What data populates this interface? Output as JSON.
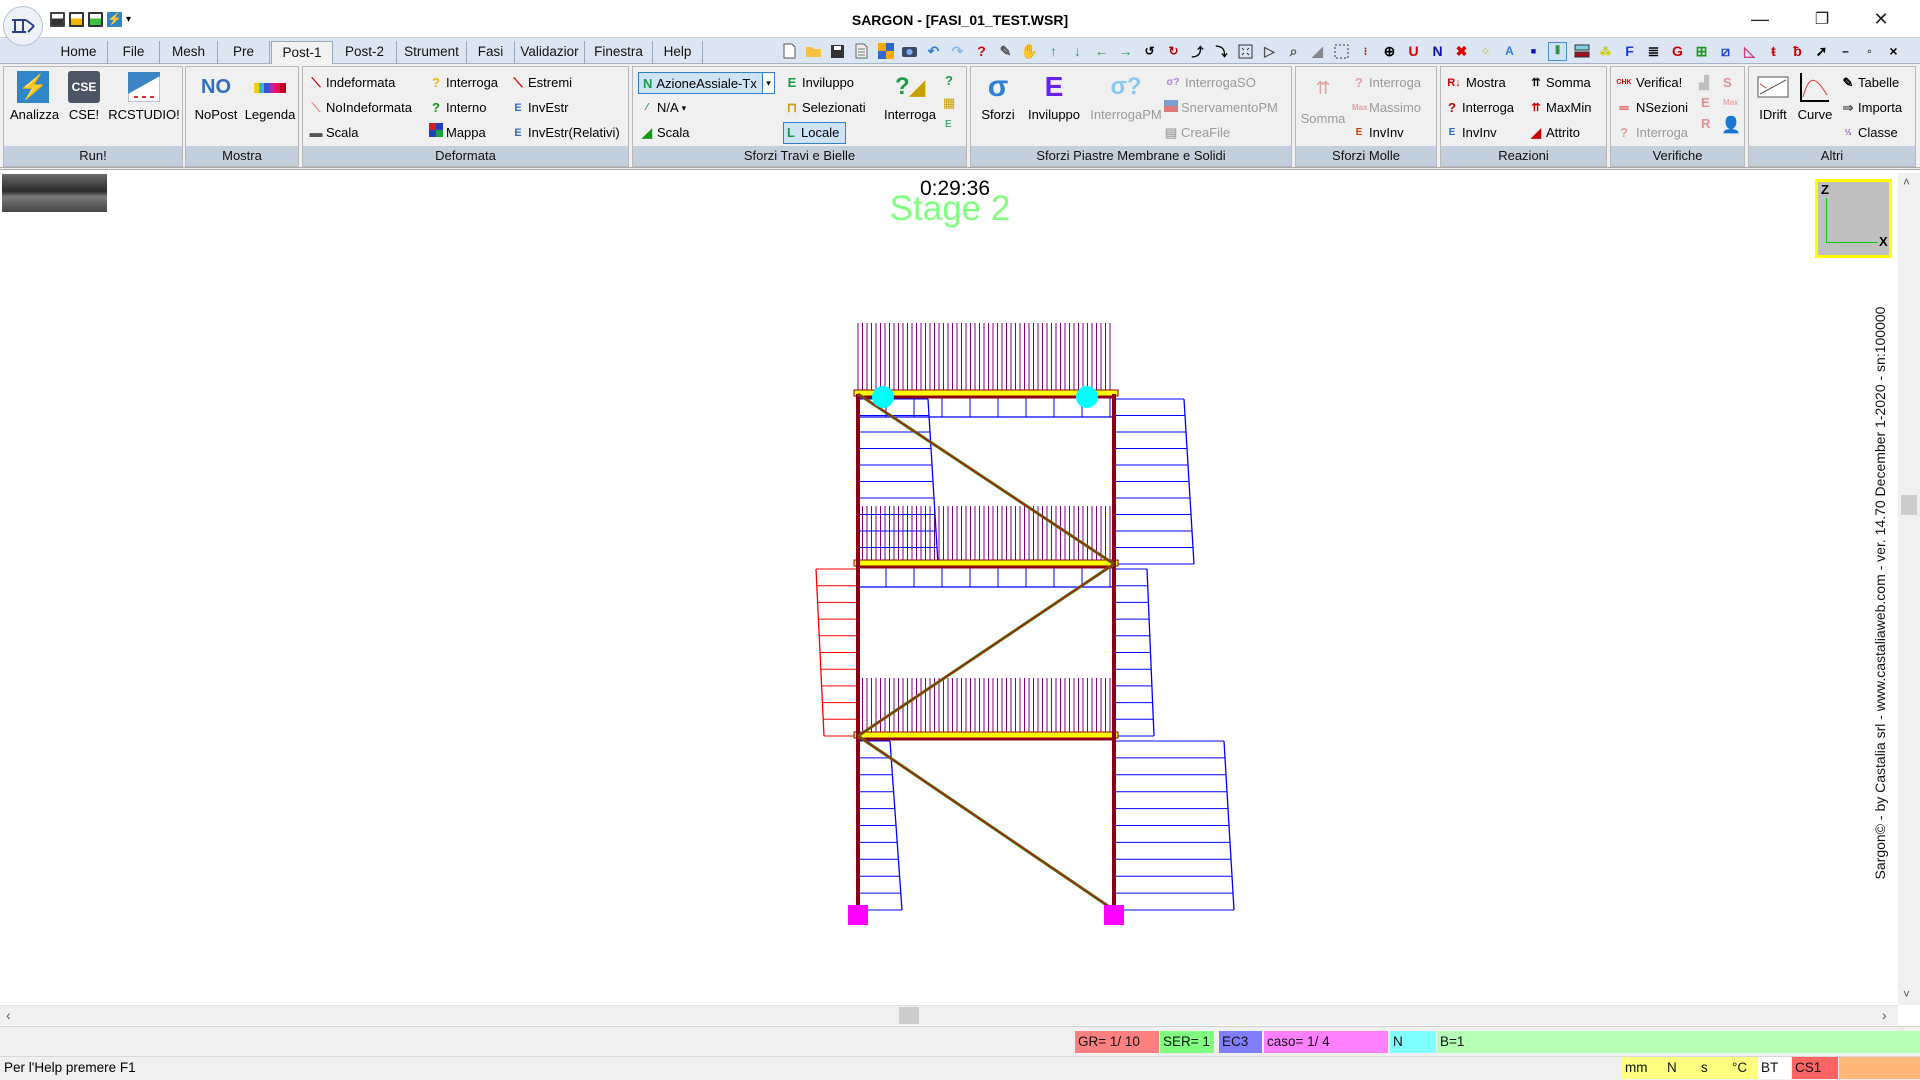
{
  "window": {
    "title": "SARGON - [FASI_01_TEST.WSR]",
    "controls": {
      "minimize": "—",
      "restore": "❐",
      "close": "✕"
    }
  },
  "quick_access": [
    "save-icon",
    "save-as-icon",
    "save-all-icon",
    "analyze-icon",
    "customize-icon"
  ],
  "menu": {
    "tabs": [
      {
        "label": "Home"
      },
      {
        "label": "File"
      },
      {
        "label": "Mesh"
      },
      {
        "label": "Pre"
      },
      {
        "label": "Post-1",
        "active": true
      },
      {
        "label": "Post-2"
      },
      {
        "label": "Strument"
      },
      {
        "label": "Fasi"
      },
      {
        "label": "Validazior"
      },
      {
        "label": "Finestra"
      },
      {
        "label": "Help"
      }
    ]
  },
  "toolbar": {
    "icons": [
      "new-icon",
      "open-icon",
      "save-icon",
      "document-icon",
      "grid-icon",
      "camera-icon",
      "undo-icon",
      "redo-icon",
      "query-icon",
      "pencil-icon",
      "hand-icon",
      "arrow-up-icon",
      "arrow-down-icon",
      "arrow-left-icon",
      "arrow-right-icon",
      "rotate-ccw-plus-icon",
      "rotate-cw-minus-icon",
      "rotate-up-plus-icon",
      "rotate-up-minus-icon",
      "zoom-extents-icon",
      "view-icon",
      "zoom-icon",
      "section-icon",
      "select-rect-icon",
      "nodes-icon",
      "axis-icon",
      "u-icon",
      "n-icon",
      "delete-node-icon",
      "points-icon",
      "a-icon",
      "square-icon",
      "beam-icon",
      "section-view-icon",
      "node-view-icon",
      "f-icon",
      "database-icon",
      "g-icon",
      "add-icon",
      "edit-icon",
      "page-icon",
      "frame-left-icon",
      "frame-right-icon",
      "pointer-help-icon"
    ],
    "glyphs": {
      "u": "U",
      "n": "N",
      "f": "F",
      "g": "G",
      "a": "A"
    },
    "inner_controls": {
      "minimize": "–",
      "restore": "▫",
      "close": "×"
    }
  },
  "ribbon": {
    "groups": [
      {
        "label": "Run!",
        "buttons": [
          {
            "label": "Analizza"
          },
          {
            "label": "CSE!",
            "icon_text": "CSE"
          },
          {
            "label": "RCSTUDIO!"
          }
        ]
      },
      {
        "label": "Mostra",
        "buttons": [
          {
            "label": "NoPost",
            "icon_text": "NO"
          },
          {
            "label": "Legenda"
          }
        ]
      },
      {
        "label": "Deformata",
        "buttons": [
          {
            "label": "Indeformata"
          },
          {
            "label": "NoIndeformata"
          },
          {
            "label": "Scala"
          },
          {
            "label": "Interroga"
          },
          {
            "label": "Interno"
          },
          {
            "label": "Mappa"
          },
          {
            "label": "Estremi"
          },
          {
            "label": "InvEstr"
          },
          {
            "label": "InvEstr(Relativi)"
          }
        ]
      },
      {
        "label": "Sforzi Travi e Bielle",
        "dropdown_value": "AzioneAssiale-Tx",
        "dropdown_prefix": "N",
        "buttons": [
          {
            "label": "N/A"
          },
          {
            "label": "Scala"
          },
          {
            "label": "Inviluppo",
            "prefix": "E"
          },
          {
            "label": "Selezionati"
          },
          {
            "label": "Locale",
            "prefix": "L",
            "active": true
          },
          {
            "label": "Interroga"
          }
        ]
      },
      {
        "label": "Sforzi Piastre Membrane e Solidi",
        "buttons": [
          {
            "label": "Sforzi",
            "icon_text": "σ"
          },
          {
            "label": "Inviluppo",
            "icon_text": "E"
          },
          {
            "label": "InterrogaPM",
            "icon_text": "σ?",
            "disabled": true
          },
          {
            "label": "InterrogaSO",
            "prefix": "σ?",
            "disabled": true
          },
          {
            "label": "SnervamentoPM",
            "disabled": true
          },
          {
            "label": "CreaFile",
            "disabled": true
          }
        ]
      },
      {
        "label": "Sforzi Molle",
        "buttons": [
          {
            "label": "Somma",
            "disabled": true
          },
          {
            "label": "Interroga",
            "disabled": true
          },
          {
            "label": "Massimo",
            "disabled": true
          },
          {
            "label": "InvInv"
          }
        ]
      },
      {
        "label": "Reazioni",
        "buttons": [
          {
            "label": "Mostra",
            "prefix": "R↓"
          },
          {
            "label": "Interroga",
            "prefix": "?"
          },
          {
            "label": "InvInv"
          },
          {
            "label": "Somma"
          },
          {
            "label": "MaxMin"
          },
          {
            "label": "Attrito"
          }
        ]
      },
      {
        "label": "Verifiche",
        "buttons": [
          {
            "label": "Verifica!",
            "prefix": "CHK"
          },
          {
            "label": "NSezioni"
          },
          {
            "label": "Interroga",
            "disabled": true
          }
        ],
        "side_letters": [
          "S",
          "E",
          "Max",
          "R"
        ]
      },
      {
        "label": "Altri",
        "buttons": [
          {
            "label": "IDrift"
          },
          {
            "label": "Curve"
          },
          {
            "label": "Tabelle"
          },
          {
            "label": "Importa"
          },
          {
            "label": "Classe"
          }
        ]
      }
    ]
  },
  "canvas": {
    "timer": "0:29:36",
    "stage_label": "Stage 2",
    "axes": {
      "z": "Z",
      "x": "X"
    },
    "copyright": "Sargon© - by Castalia srl - www.castaliaweb.com - ver. 14.70 December 1-2020 - sn:100000",
    "colors": {
      "column": "#8b0015",
      "brace": "#6b6b00",
      "brace_center": "#d00000",
      "load": "#800080",
      "slab": "#ffff00",
      "diagram_pos": "#0000ff",
      "diagram_neg": "#ff0000",
      "support": "#ff00ff",
      "node_marker": "#00ffff",
      "stage": "#80ff80"
    }
  },
  "statusbar": {
    "help_text": "Per l'Help premere F1",
    "cells_top": [
      {
        "text": "GR=  1/ 10",
        "color": "#ff8080"
      },
      {
        "text": "SER=  1",
        "color": "#80ff80"
      },
      {
        "text": "EC3",
        "color": "#8080ff"
      },
      {
        "text": "caso=     1/    4",
        "color": "#ff80ff"
      },
      {
        "text": "N",
        "color": "#80ffff"
      },
      {
        "text": "B=1",
        "color": "#b6ffb6"
      }
    ],
    "cells_bottom": [
      {
        "text": "mm",
        "color": "#ffff80"
      },
      {
        "text": "N",
        "color": "#ffff80"
      },
      {
        "text": "s",
        "color": "#ffff80"
      },
      {
        "text": "°C",
        "color": "#ffff80"
      },
      {
        "text": "BT",
        "color": "#ffffff"
      },
      {
        "text": "CS1",
        "color": "#ff6464"
      },
      {
        "text": "",
        "color": "#ffb878"
      }
    ]
  }
}
